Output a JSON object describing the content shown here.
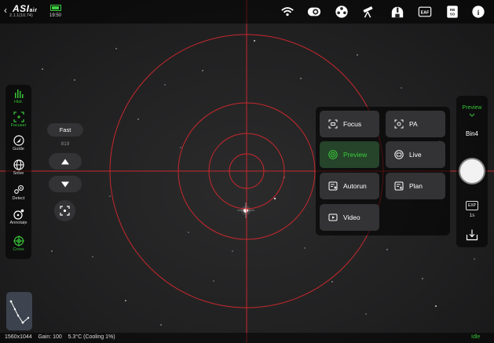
{
  "app": {
    "brand_main": "ASI",
    "brand_sub": "air",
    "version": "2.1.1(10.74)",
    "back_icon": "chevron-left-icon",
    "clock": "19:50",
    "battery_color": "#3ed03e"
  },
  "toolbar": {
    "icons": [
      "wifi-icon",
      "camera-status-icon",
      "filter-wheel-icon",
      "telescope-mount-icon",
      "observatory-icon",
      "eaf-icon",
      "rb-so-icon",
      "info-icon"
    ],
    "eaf_label": "EAF",
    "rb_label": "RB",
    "so_label": "SO",
    "info_label": "i"
  },
  "left_toolbar": {
    "items": [
      {
        "label": "Hist.",
        "icon": "histogram-icon",
        "active": true
      },
      {
        "label": "Focuser",
        "icon": "focuser-icon",
        "active": true
      },
      {
        "label": "Guide",
        "icon": "guide-icon",
        "active": false
      },
      {
        "label": "Solve",
        "icon": "globe-icon",
        "active": false
      },
      {
        "label": "Detect",
        "icon": "detect-icon",
        "active": false
      },
      {
        "label": "Annotate",
        "icon": "annotate-icon",
        "active": false
      },
      {
        "label": "Cross",
        "icon": "crosshair-icon",
        "active": true
      }
    ]
  },
  "focuser": {
    "speed_label": "Fast",
    "position": "819"
  },
  "modes": [
    {
      "label": "Focus",
      "icon": "focus-mode-icon",
      "active": false
    },
    {
      "label": "PA",
      "icon": "polar-align-icon",
      "active": false
    },
    {
      "label": "Preview",
      "icon": "preview-mode-icon",
      "active": true
    },
    {
      "label": "Live",
      "icon": "live-mode-icon",
      "active": false
    },
    {
      "label": "Autorun",
      "icon": "autorun-icon",
      "active": false
    },
    {
      "label": "Plan",
      "icon": "plan-icon",
      "active": false
    },
    {
      "label": "Video",
      "icon": "video-icon",
      "active": false
    }
  ],
  "right_panel": {
    "mode_label": "Preview",
    "binning": "Bin4",
    "exp_label": "EXP",
    "exposure": "1s"
  },
  "status": {
    "resolution": "1560x1044",
    "gain": "Gain: 100",
    "temperature": "5.3°C (Cooling 1%)",
    "state": "Idle"
  },
  "colors": {
    "accent_green": "#36c136",
    "crosshair_red": "#c8282c"
  }
}
